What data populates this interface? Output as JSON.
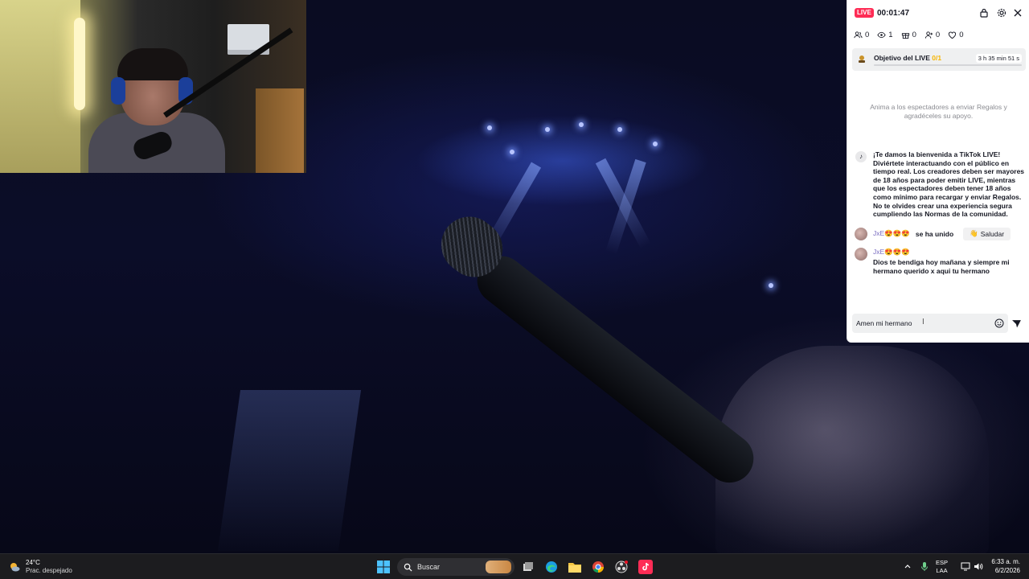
{
  "live_panel": {
    "badge": "LIVE",
    "timer": "00:01:47",
    "stats": {
      "viewers_joined": "0",
      "views": "1",
      "gifts": "0",
      "new_followers": "0",
      "likes": "0"
    },
    "goal": {
      "title": "Objetivo del LIVE",
      "progress": "0/1",
      "progress_fraction": 0,
      "time_left": "3 h 35 min 51 s"
    },
    "prompt": "Anima a los espectadores a enviar Regalos y agradéceles su apoyo.",
    "system_message": "¡Te damos la bienvenida a TikTok LIVE! Diviértete interactuando con el público en tiempo real. Los creadores deben ser mayores de 18 años para poder emitir LIVE, mientras que los espectadores deben tener 18 años como mínimo para recargar y enviar Regalos. No te olvides crear una experiencia segura cumpliendo las Normas de la comunidad.",
    "join_event": {
      "user": "JxE😍😍😍",
      "text": "se ha unido",
      "greet_label": "Saludar"
    },
    "comment": {
      "user": "JxE😍😍😍",
      "text": "Dios te bendiga hoy mañana y siempre mi hermano querido x aqui tu hermano"
    },
    "input_value": "Amen mi hermano"
  },
  "taskbar": {
    "weather_temp": "24°C",
    "weather_condition": "Prac. despejado",
    "search_label": "Buscar",
    "lang_line1": "ESP",
    "lang_line2": "LAA",
    "time": "6:33 a. m.",
    "date": "6/2/2026"
  },
  "colors": {
    "accent": "#fe2c55",
    "goal_accent": "#f7b500",
    "username": "#7a6dc0",
    "taskbar": "#1c1c1f"
  },
  "icons": [
    "lock-icon",
    "settings-icon",
    "close-icon",
    "users-icon",
    "eye-icon",
    "gift-icon",
    "follower-icon",
    "heart-icon",
    "tiktok-icon",
    "wave-icon",
    "emoji-icon",
    "send-icon",
    "windows-start-icon",
    "search-icon",
    "task-view-icon",
    "edge-icon",
    "file-explorer-icon",
    "chrome-icon",
    "obs-icon",
    "tiktok-live-studio-icon"
  ]
}
